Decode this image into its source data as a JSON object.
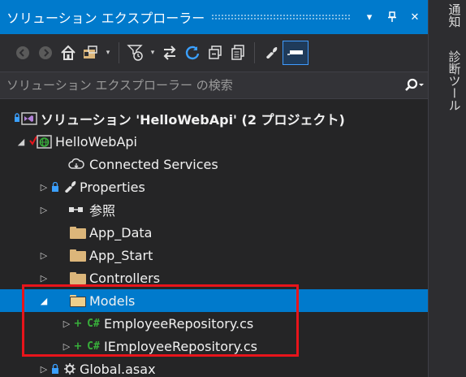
{
  "window": {
    "title": "ソリューション エクスプローラー",
    "dropdown_glyph": "▾",
    "pin_glyph": "⊥",
    "close_glyph": "✕"
  },
  "toolbar": {
    "icons": [
      "back-icon",
      "forward-icon",
      "home-icon",
      "switch-views-icon",
      "dropdown-arrow",
      "pending-changes-filter-icon",
      "dropdown-arrow",
      "sync-with-active-document-icon",
      "refresh-icon",
      "collapse-all-icon",
      "show-all-files-icon",
      "properties-icon",
      "preview-selected-items-icon"
    ]
  },
  "search": {
    "placeholder": "ソリューション エクスプローラー の検索"
  },
  "tree": {
    "solution": "ソリューション 'HelloWebApi' (2 プロジェクト)",
    "project": "HelloWebApi",
    "items": {
      "connected_services": "Connected Services",
      "properties": "Properties",
      "references": "参照",
      "app_data": "App_Data",
      "app_start": "App_Start",
      "controllers": "Controllers",
      "models": "Models",
      "employee_repository": "EmployeeRepository.cs",
      "iemployee_repository": "IEmployeeRepository.cs",
      "global_asax": "Global.asax"
    },
    "csharp_glyph": "C#"
  },
  "side_tabs": {
    "notifications": "通知",
    "diagnostic_tools": "診断ツール"
  },
  "colors": {
    "accent": "#007acc",
    "highlight_box": "#e8141b",
    "folder": "#dcb67a",
    "csharp": "#38b13b"
  }
}
